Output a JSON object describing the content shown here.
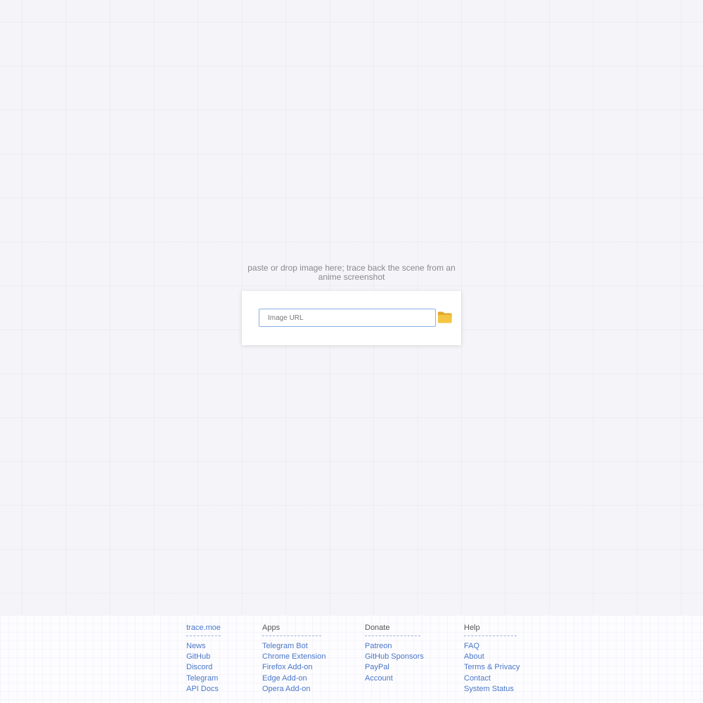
{
  "search": {
    "hint": "paste or drop image here; trace back the scene from an anime screenshot",
    "placeholder": "Image URL",
    "value": "",
    "browse_icon": "folder-icon"
  },
  "footer": {
    "columns": [
      {
        "heading": "trace.moe",
        "heading_is_link": true,
        "links": [
          "News",
          "GitHub",
          "Discord",
          "Telegram",
          "API Docs"
        ]
      },
      {
        "heading": "Apps",
        "heading_is_link": false,
        "links": [
          "Telegram Bot",
          "Chrome Extension",
          "Firefox Add-on",
          "Edge Add-on",
          "Opera Add-on"
        ]
      },
      {
        "heading": "Donate",
        "heading_is_link": false,
        "links": [
          "Patreon",
          "GitHub Sponsors",
          "PayPal",
          "Account"
        ]
      },
      {
        "heading": "Help",
        "heading_is_link": false,
        "links": [
          "FAQ",
          "About",
          "Terms & Privacy",
          "Contact",
          "System Status"
        ]
      }
    ]
  },
  "colors": {
    "background": "#f5f5f9",
    "link": "#4a76c8",
    "input_border": "#8ab0e6",
    "folder": "#f4c542"
  }
}
